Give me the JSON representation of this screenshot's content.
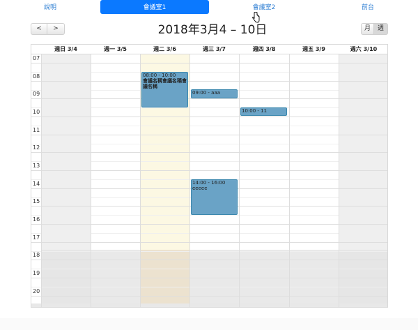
{
  "nav": {
    "items": [
      {
        "label": "說明"
      },
      {
        "label": "會議室1"
      },
      {
        "label": "會議室2"
      },
      {
        "label": "前台"
      }
    ]
  },
  "toolbar": {
    "prev_label": "<",
    "next_label": ">",
    "title": "2018年3月4 – 10日",
    "month_label": "月",
    "week_label": "週"
  },
  "calendar": {
    "days": [
      {
        "label": "週日 3/4"
      },
      {
        "label": "週一 3/5"
      },
      {
        "label": "週二 3/6"
      },
      {
        "label": "週三 3/7"
      },
      {
        "label": "週四 3/8"
      },
      {
        "label": "週五 3/9"
      },
      {
        "label": "週六 3/10"
      }
    ],
    "hours": [
      "07",
      "08",
      "09",
      "10",
      "11",
      "12",
      "13",
      "14",
      "15",
      "16",
      "17",
      "18",
      "19",
      "20"
    ],
    "events": [
      {
        "time": "08:00 - 10:00",
        "title": "會議名稱會議名稱會議名稱"
      },
      {
        "time": "09:00 - aaa",
        "title": ""
      },
      {
        "time": "10:00 - 11",
        "title": ""
      },
      {
        "time": "14:00 - 16:00",
        "title": "eeeee"
      }
    ]
  },
  "colors": {
    "accent": "#0b79ff",
    "event": "#6aa3c6",
    "today": "#fcf8e3"
  }
}
